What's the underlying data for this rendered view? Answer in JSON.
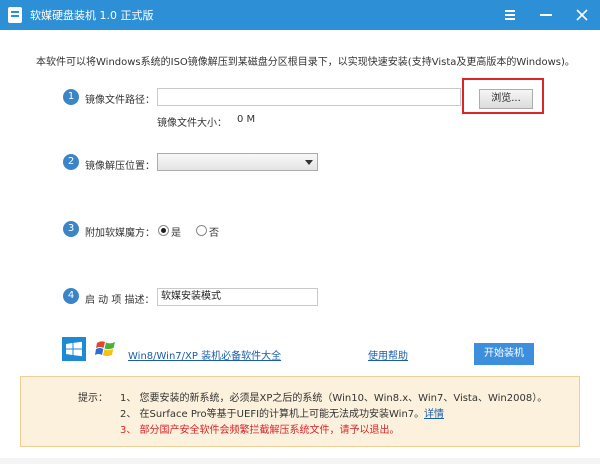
{
  "window": {
    "title": "软媒硬盘装机 1.0 正式版"
  },
  "description": "本软件可以将Windows系统的ISO镜像解压到某磁盘分区根目录下，以实现快速安装(支持Vista及更高版本的Windows)。",
  "steps": {
    "image_path": {
      "number": "1",
      "label": "镜像文件路径：",
      "value": "",
      "browse_label": "浏览...",
      "size_label": "镜像文件大小：",
      "size_value": "0 M"
    },
    "extract_location": {
      "number": "2",
      "label": "镜像解压位置：",
      "selected": ""
    },
    "magic_cube": {
      "number": "3",
      "label": "附加软媒魔方：",
      "option_yes": "是",
      "option_no": "否",
      "selected": "是"
    },
    "boot_desc": {
      "number": "4",
      "label": "启 动 项 描述：",
      "value": "软媒安装模式"
    }
  },
  "footer": {
    "software_link": "Win8/Win7/XP 装机必备软件大全",
    "help_link": "使用帮助",
    "start_button": "开始装机"
  },
  "tips": {
    "prefix": "提示：",
    "line1": "1、 您要安装的新系统，必须是XP之后的系统（Win10、Win8.x、Win7、Vista、Win2008）。",
    "line2": "2、 在Surface Pro等基于UEFI的计算机上可能无法成功安装Win7。",
    "line2_link": "详情",
    "line3": "3、 部分国产安全软件会频繁拦截解压系统文件，请予以退出。"
  },
  "colors": {
    "titlebar": "#2d8fd6",
    "step_circle": "#3c84c8",
    "start_button": "#3c8fdc",
    "highlight": "#d9262b",
    "tips_background": "#fcf1dd",
    "warning_text": "#d9262b",
    "link": "#1a5ea8"
  },
  "icons": [
    "app-icon",
    "menu-icon",
    "minimize-icon",
    "close-icon",
    "windows8-logo-icon",
    "windows-xp-logo-icon",
    "dropdown-arrow-icon"
  ]
}
